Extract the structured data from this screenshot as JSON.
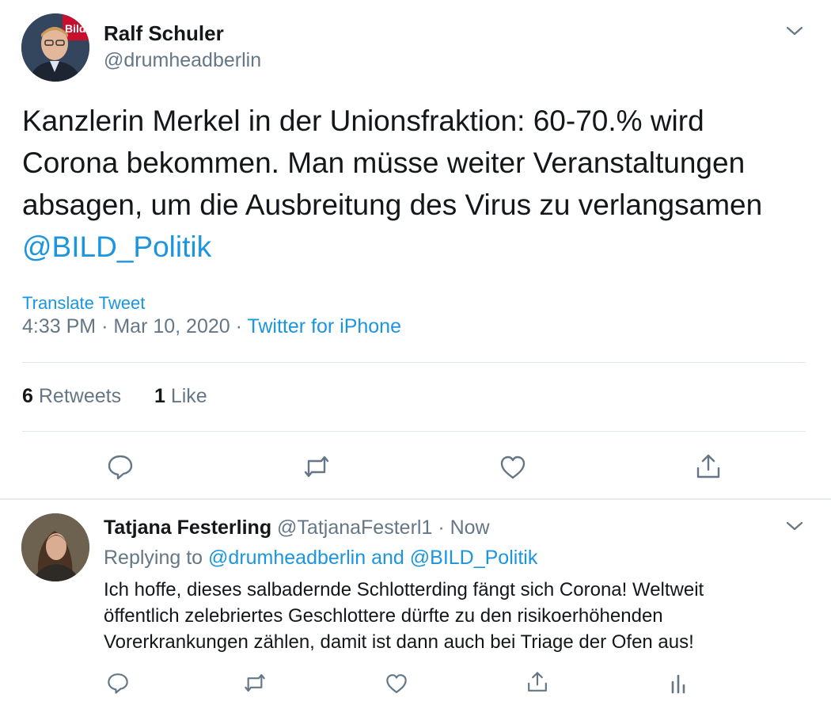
{
  "tweet": {
    "author_name": "Ralf Schuler",
    "author_handle": "@drumheadberlin",
    "text_line1": "Kanzlerin Merkel in der Unionsfraktion: 60-70.% wird",
    "text_line2": "Corona bekommen. Man müsse weiter Veranstaltungen",
    "text_line3": "absagen, um die Ausbreitung des Virus zu verlangsamen",
    "mention": "@BILD_Politik",
    "translate_label": "Translate Tweet",
    "time": "4:33 PM",
    "separator": "·",
    "date": "Mar 10, 2020",
    "source": "Twitter for iPhone",
    "retweets_count": "6",
    "retweets_label": "Retweets",
    "likes_count": "1",
    "likes_label": "Like",
    "avatar_badge": "Bild"
  },
  "reply": {
    "author_name": "Tatjana Festerling",
    "author_handle": "@TatjanaFesterl1",
    "separator": "·",
    "time": "Now",
    "replying_prefix": "Replying to",
    "replying_user1": "@drumheadberlin",
    "replying_and": "and",
    "replying_user2": "@BILD_Politik",
    "text_line1": "Ich hoffe, dieses salbadernde Schlotterding fängt sich Corona! Weltweit",
    "text_line2": "öffentlich zelebriertes Geschlottere dürfte zu den risikoerhöhenden",
    "text_line3": "Vorerkrankungen zählen, damit ist dann auch bei Triage der Ofen aus!"
  },
  "colors": {
    "link": "#1b95e0",
    "secondary_text": "#657786",
    "primary_text": "#14171a",
    "divider": "#e1e8ed"
  },
  "icons": [
    "chevron-down-icon",
    "reply-icon",
    "retweet-icon",
    "like-icon",
    "share-icon",
    "analytics-icon"
  ]
}
